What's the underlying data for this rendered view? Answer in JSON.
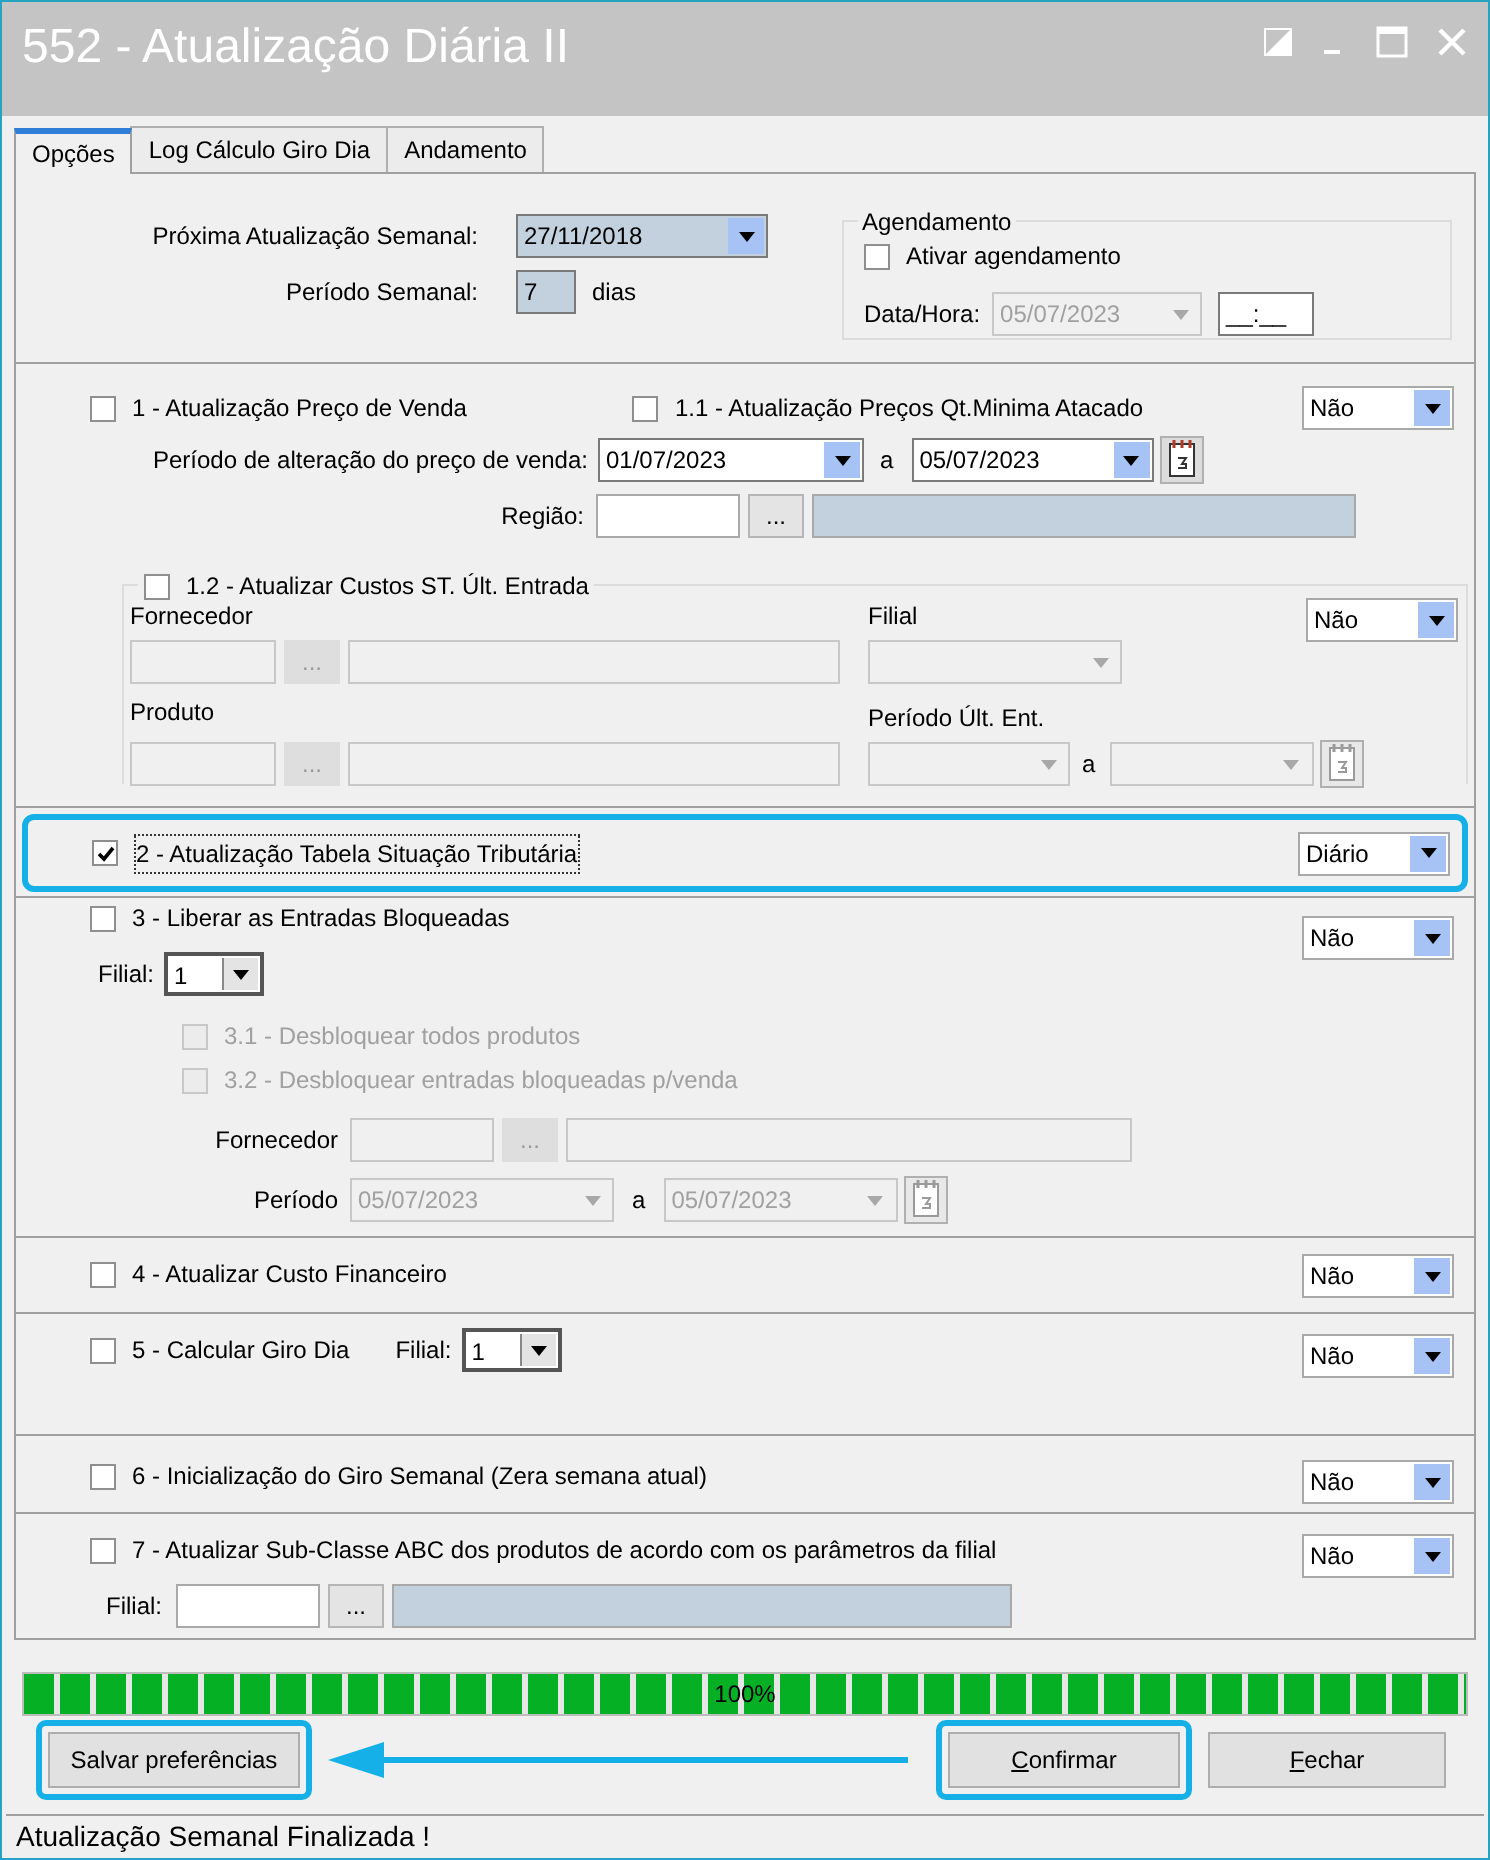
{
  "window": {
    "title": "552 - Atualização Diária II"
  },
  "tabs": [
    {
      "label": "Opções",
      "selected": true
    },
    {
      "label": "Log Cálculo Giro Dia",
      "selected": false
    },
    {
      "label": "Andamento",
      "selected": false
    }
  ],
  "weekly": {
    "next_update_label": "Próxima Atualização Semanal:",
    "next_update": "27/11/2018",
    "period_label": "Período Semanal:",
    "period": "7",
    "period_unit": "dias"
  },
  "scheduling": {
    "title": "Agendamento",
    "enable": {
      "label": "Ativar agendamento",
      "checked": false
    },
    "datetime_label": "Data/Hora:",
    "date": "05/07/2023",
    "date_disabled": true,
    "time": "__:__"
  },
  "price_update": {
    "option": {
      "label": "1 - Atualização Preço de Venda",
      "checked": false
    },
    "wholesale": {
      "label": "1.1 - Atualização Preços Qt.Minima Atacado",
      "checked": false
    },
    "mode": "Não",
    "period_label": "Período de alteração do preço de venda:",
    "date_from": "01/07/2023",
    "separator": "a",
    "date_to": "05/07/2023",
    "region_label": "Região:",
    "browse_button": "..."
  },
  "st_costs": {
    "option": {
      "label": "1.2 - Atualizar Custos ST. Últ. Entrada",
      "checked": false
    },
    "mode": "Não",
    "fields_disabled": true,
    "supplier_label": "Fornecedor",
    "supplier_button": "...",
    "branch_label": "Filial",
    "product_label": "Produto",
    "product_button": "...",
    "period_label": "Período Últ. Ent.",
    "separator": "a"
  },
  "tax_table": {
    "option": {
      "label": "2 - Atualização Tabela Situação Tributária",
      "checked": true
    },
    "mode": "Diário",
    "highlighted": true
  },
  "release_entries": {
    "option": {
      "label": "3 - Liberar as Entradas Bloqueadas",
      "checked": false
    },
    "mode": "Não",
    "branch_label": "Filial:",
    "branch": "1",
    "sub_options": [
      {
        "label": "3.1 - Desbloquear todos produtos",
        "checked": false,
        "disabled": true
      },
      {
        "label": "3.2 - Desbloquear entradas bloqueadas p/venda",
        "checked": false,
        "disabled": true
      }
    ],
    "fields_disabled": true,
    "supplier_label": "Fornecedor",
    "browse_button": "...",
    "period_label": "Período",
    "date_from": "05/07/2023",
    "separator": "a",
    "date_to": "05/07/2023"
  },
  "financial_cost": {
    "option": {
      "label": "4 - Atualizar Custo Financeiro",
      "checked": false
    },
    "mode": "Não"
  },
  "daily_turnover": {
    "option": {
      "label": "5 - Calcular Giro Dia",
      "checked": false
    },
    "mode": "Não",
    "branch_label": "Filial:",
    "branch": "1"
  },
  "weekly_reset": {
    "option": {
      "label": "6 - Inicialização do Giro Semanal (Zera semana atual)",
      "checked": false
    },
    "mode": "Não"
  },
  "abc_subclass": {
    "option": {
      "label": "7 - Atualizar Sub-Classe ABC dos produtos de acordo com os parâmetros da filial",
      "checked": false
    },
    "mode": "Não",
    "branch_label": "Filial:",
    "browse_button": "..."
  },
  "progress": {
    "level": 1,
    "text": "100%"
  },
  "buttons": [
    {
      "label": "Salvar preferências",
      "highlighted": true
    },
    {
      "label": "Confirmar",
      "highlighted": true
    },
    {
      "label": "Fechar",
      "highlighted": false
    }
  ],
  "status_bar": "Atualização Semanal Finalizada !"
}
